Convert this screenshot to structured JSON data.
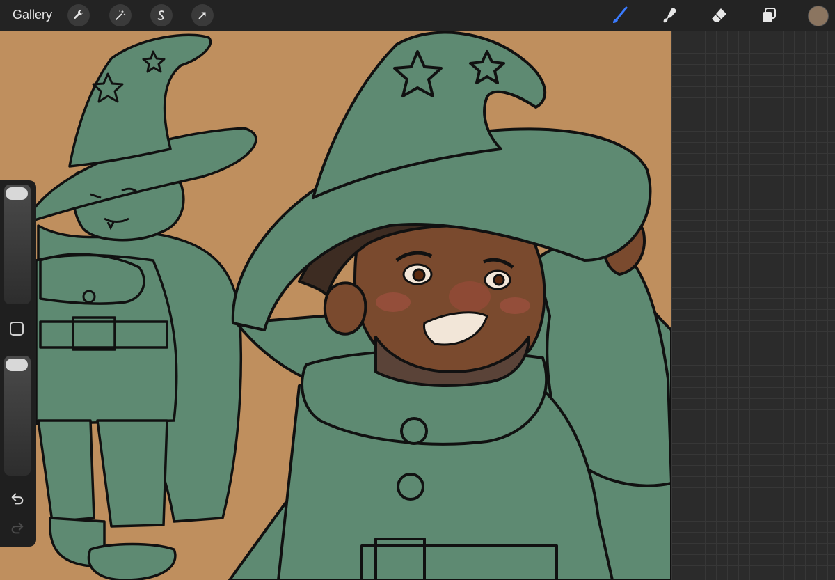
{
  "topbar": {
    "gallery_label": "Gallery",
    "left_tools": [
      "wrench-icon",
      "magic-wand-icon",
      "selection-s-icon",
      "arrow-transform-icon"
    ],
    "right_tools": [
      "brush-icon",
      "smudge-icon",
      "eraser-icon",
      "layers-icon"
    ],
    "active_tool": "brush-icon",
    "accent_color": "#3a7bff",
    "current_color": "#8b7560"
  },
  "canvas": {
    "background_color": "#bf8f5e",
    "robe_color": "#5e8a72",
    "skin_color": "#7a4a2e",
    "hair_color": "#3d2c22"
  },
  "sidebar": {
    "brush_size_slider": "brush-size",
    "opacity_slider": "opacity",
    "modify_button": "square-icon",
    "undo": "undo-icon",
    "redo": "redo-icon"
  }
}
